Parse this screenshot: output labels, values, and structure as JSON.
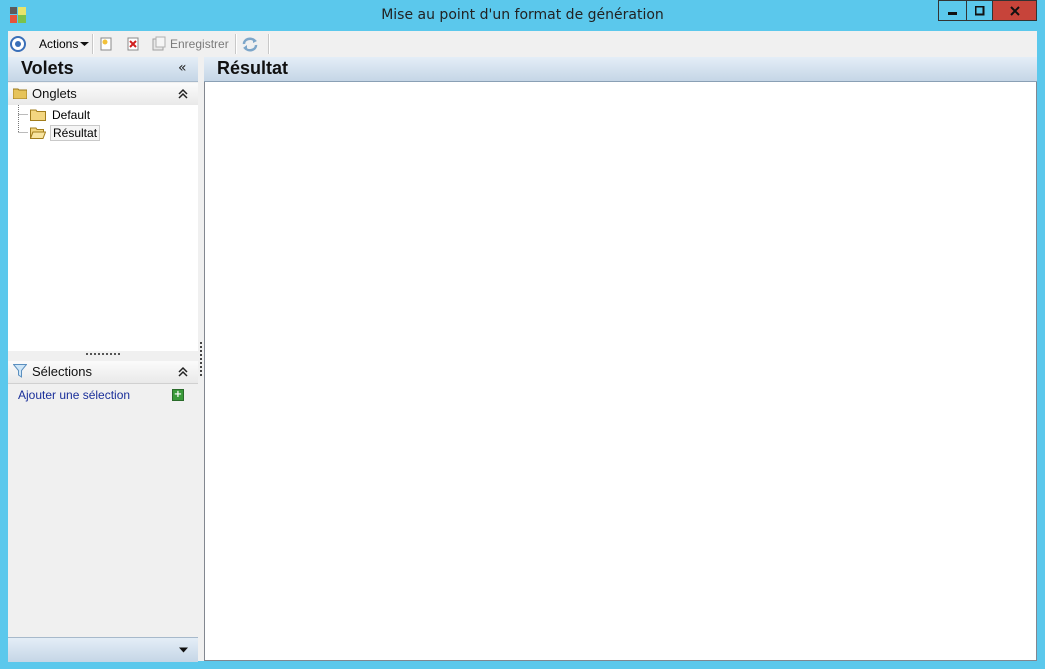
{
  "window": {
    "title": "Mise au point d'un format de génération"
  },
  "toolbar": {
    "actions_label": "Actions",
    "save_label": "Enregistrer"
  },
  "left_panel": {
    "title": "Volets",
    "collapse_glyph": "«",
    "onglets": {
      "title": "Onglets",
      "items": [
        {
          "label": "Default",
          "selected": false
        },
        {
          "label": "Résultat",
          "selected": true
        }
      ]
    },
    "selections": {
      "title": "Sélections",
      "add_label": "Ajouter une sélection"
    }
  },
  "main": {
    "title": "Résultat"
  },
  "colors": {
    "frame": "#5bc8ec",
    "close_button": "#c7443a",
    "header_gradient_top": "#e4eef7",
    "header_gradient_bottom": "#c5d6e6",
    "link": "#1a2f9a"
  }
}
